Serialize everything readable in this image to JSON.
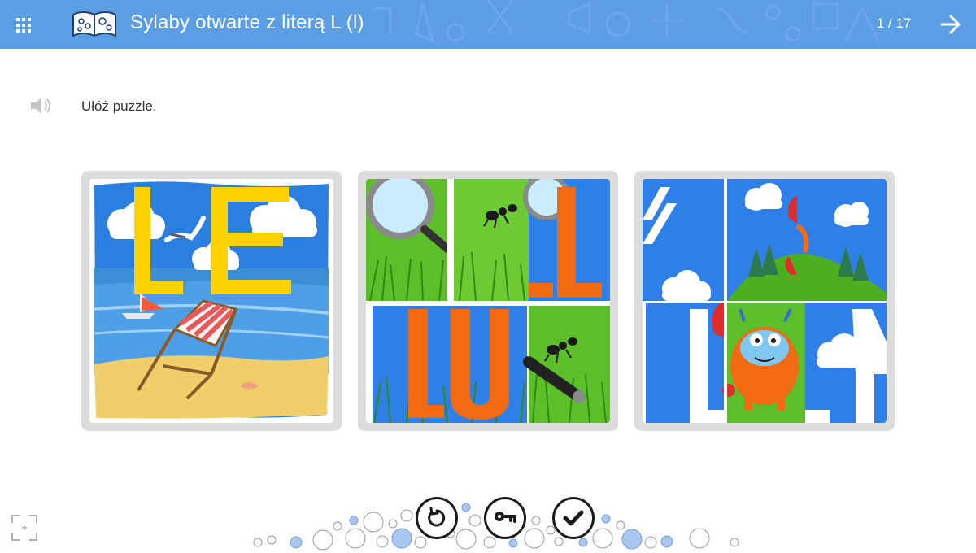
{
  "header": {
    "title": "Sylaby otwarte z literą L (l)",
    "counter": "1 / 17",
    "menu_icon": "grid-icon",
    "next_icon": "arrow-right-icon",
    "logo": "book-logo",
    "color": "#5b9ee3"
  },
  "task": {
    "instruction": "Ułóż puzzle.",
    "audio_icon": "speaker-icon"
  },
  "cards": [
    {
      "name": "puzzle-card-beach",
      "letters": "LE"
    },
    {
      "name": "puzzle-card-ant",
      "letters": "LU"
    },
    {
      "name": "puzzle-card-monster",
      "letters": "LY"
    }
  ],
  "controls": {
    "reset_icon": "reset-icon",
    "hint_icon": "key-icon",
    "check_icon": "checkmark-icon",
    "fullscreen_icon": "fullscreen-icon"
  },
  "colors": {
    "accent": "#5b9ee3",
    "letter_yellow": "#ffd200",
    "letter_orange": "#f26b13",
    "sky": "#2e7fe8",
    "grass": "#4caf1e"
  }
}
